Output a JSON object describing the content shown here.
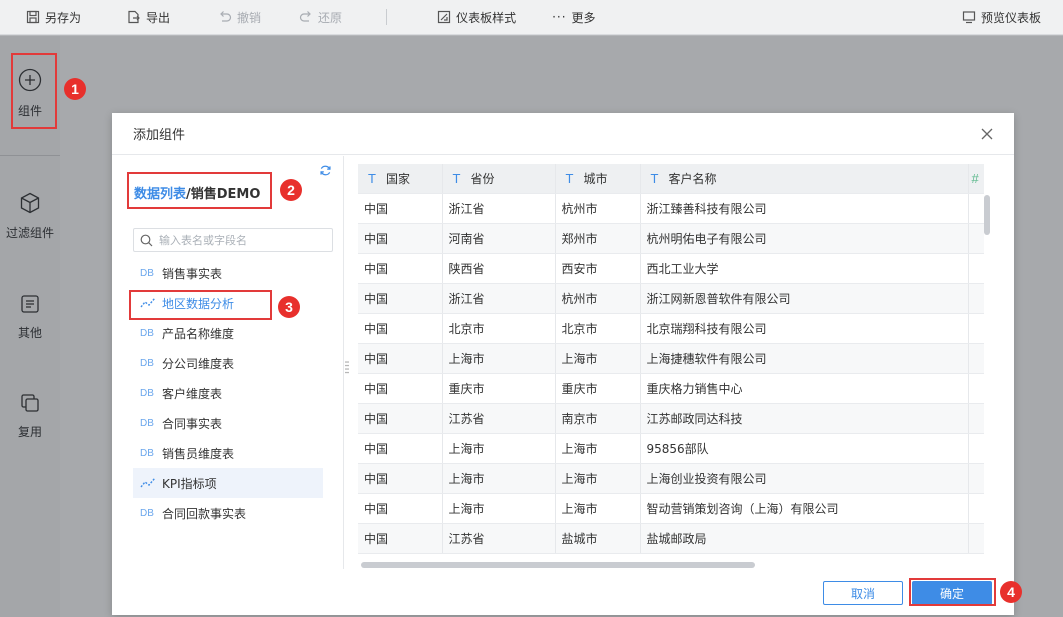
{
  "toolbar": {
    "save_as": "另存为",
    "export": "导出",
    "undo": "撤销",
    "redo": "还原",
    "dashboard_style": "仪表板样式",
    "more": "更多",
    "preview": "预览仪表板"
  },
  "rail": {
    "component": "组件",
    "filter": "过滤组件",
    "other": "其他",
    "reuse": "复用"
  },
  "badges": [
    "1",
    "2",
    "3",
    "4"
  ],
  "dialog": {
    "title": "添加组件",
    "breadcrumb_link": "数据列表",
    "breadcrumb_sep": "/",
    "breadcrumb_current": "销售DEMO",
    "search_placeholder": "输入表名或字段名",
    "tables": [
      {
        "icon": "DB",
        "label": "销售事实表"
      },
      {
        "icon": "analysis",
        "label": "地区数据分析"
      },
      {
        "icon": "DB",
        "label": "产品名称维度"
      },
      {
        "icon": "DB",
        "label": "分公司维度表"
      },
      {
        "icon": "DB",
        "label": "客户维度表"
      },
      {
        "icon": "DB",
        "label": "合同事实表"
      },
      {
        "icon": "DB",
        "label": "销售员维度表"
      },
      {
        "icon": "analysis",
        "label": "KPI指标项"
      },
      {
        "icon": "DB",
        "label": "合同回款事实表"
      }
    ],
    "columns": [
      {
        "type": "T",
        "label": "国家"
      },
      {
        "type": "T",
        "label": "省份"
      },
      {
        "type": "T",
        "label": "城市"
      },
      {
        "type": "T",
        "label": "客户名称"
      },
      {
        "type": "#",
        "label": ""
      }
    ],
    "rows": [
      [
        "中国",
        "浙江省",
        "杭州市",
        "浙江臻善科技有限公司"
      ],
      [
        "中国",
        "河南省",
        "郑州市",
        "杭州明佑电子有限公司"
      ],
      [
        "中国",
        "陕西省",
        "西安市",
        "西北工业大学"
      ],
      [
        "中国",
        "浙江省",
        "杭州市",
        "浙江网新恩普软件有限公司"
      ],
      [
        "中国",
        "北京市",
        "北京市",
        "北京瑞翔科技有限公司"
      ],
      [
        "中国",
        "上海市",
        "上海市",
        "上海捷穗软件有限公司"
      ],
      [
        "中国",
        "重庆市",
        "重庆市",
        "重庆格力销售中心"
      ],
      [
        "中国",
        "江苏省",
        "南京市",
        "江苏邮政同达科技"
      ],
      [
        "中国",
        "上海市",
        "上海市",
        "95856部队"
      ],
      [
        "中国",
        "上海市",
        "上海市",
        "上海创业投资有限公司"
      ],
      [
        "中国",
        "上海市",
        "上海市",
        "智动营销策划咨询（上海）有限公司"
      ],
      [
        "中国",
        "江苏省",
        "盐城市",
        "盐城邮政局"
      ]
    ],
    "cancel": "取消",
    "confirm": "确定"
  },
  "colors": {
    "accent": "#3e8ce6",
    "highlight": "#e23a3a"
  }
}
